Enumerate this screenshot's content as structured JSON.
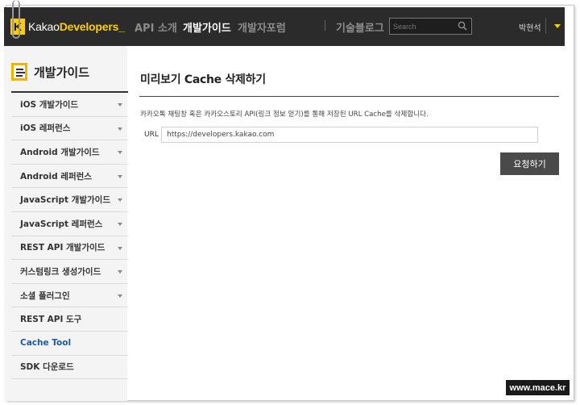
{
  "header": {
    "logo_mark": "K",
    "logo_brand": "Kakao",
    "logo_product": "Developers_",
    "nav": [
      {
        "label": "API 소개",
        "active": false
      },
      {
        "label": "개발가이드",
        "active": true
      },
      {
        "label": "개발자포럼",
        "active": false
      },
      {
        "label": "기술블로그",
        "active": false
      }
    ],
    "search_placeholder": "Search",
    "user_name": "박현석"
  },
  "sidebar": {
    "title": "개발가이드",
    "items": [
      {
        "label": "iOS 개발가이드",
        "expandable": true,
        "active": false
      },
      {
        "label": "iOS 레퍼런스",
        "expandable": true,
        "active": false
      },
      {
        "label": "Android 개발가이드",
        "expandable": true,
        "active": false
      },
      {
        "label": "Android 레퍼런스",
        "expandable": true,
        "active": false
      },
      {
        "label": "JavaScript 개발가이드",
        "expandable": true,
        "active": false
      },
      {
        "label": "JavaScript 레퍼런스",
        "expandable": true,
        "active": false
      },
      {
        "label": "REST API 개발가이드",
        "expandable": true,
        "active": false
      },
      {
        "label": "커스텀링크 생성가이드",
        "expandable": true,
        "active": false
      },
      {
        "label": "소셜 플러그인",
        "expandable": true,
        "active": false
      },
      {
        "label": "REST API 도구",
        "expandable": false,
        "active": false
      },
      {
        "label": "Cache Tool",
        "expandable": false,
        "active": true
      },
      {
        "label": "SDK 다운로드",
        "expandable": false,
        "active": false
      }
    ]
  },
  "main": {
    "title": "미리보기 Cache 삭제하기",
    "description": "카카오톡 채팅창 혹은 카카오스토리 API(링크 정보 얻기)를 통해 저장된 URL Cache를 삭제합니다.",
    "url_label": "URL",
    "url_value": "https://developers.kakao.com",
    "submit_label": "요청하기"
  },
  "watermark": "www.mace.kr",
  "colors": {
    "header_bg": "#2b2b2b",
    "brand_yellow": "#ffcd00",
    "active_link": "#1a5aa5",
    "button_bg": "#4a4a4a"
  }
}
